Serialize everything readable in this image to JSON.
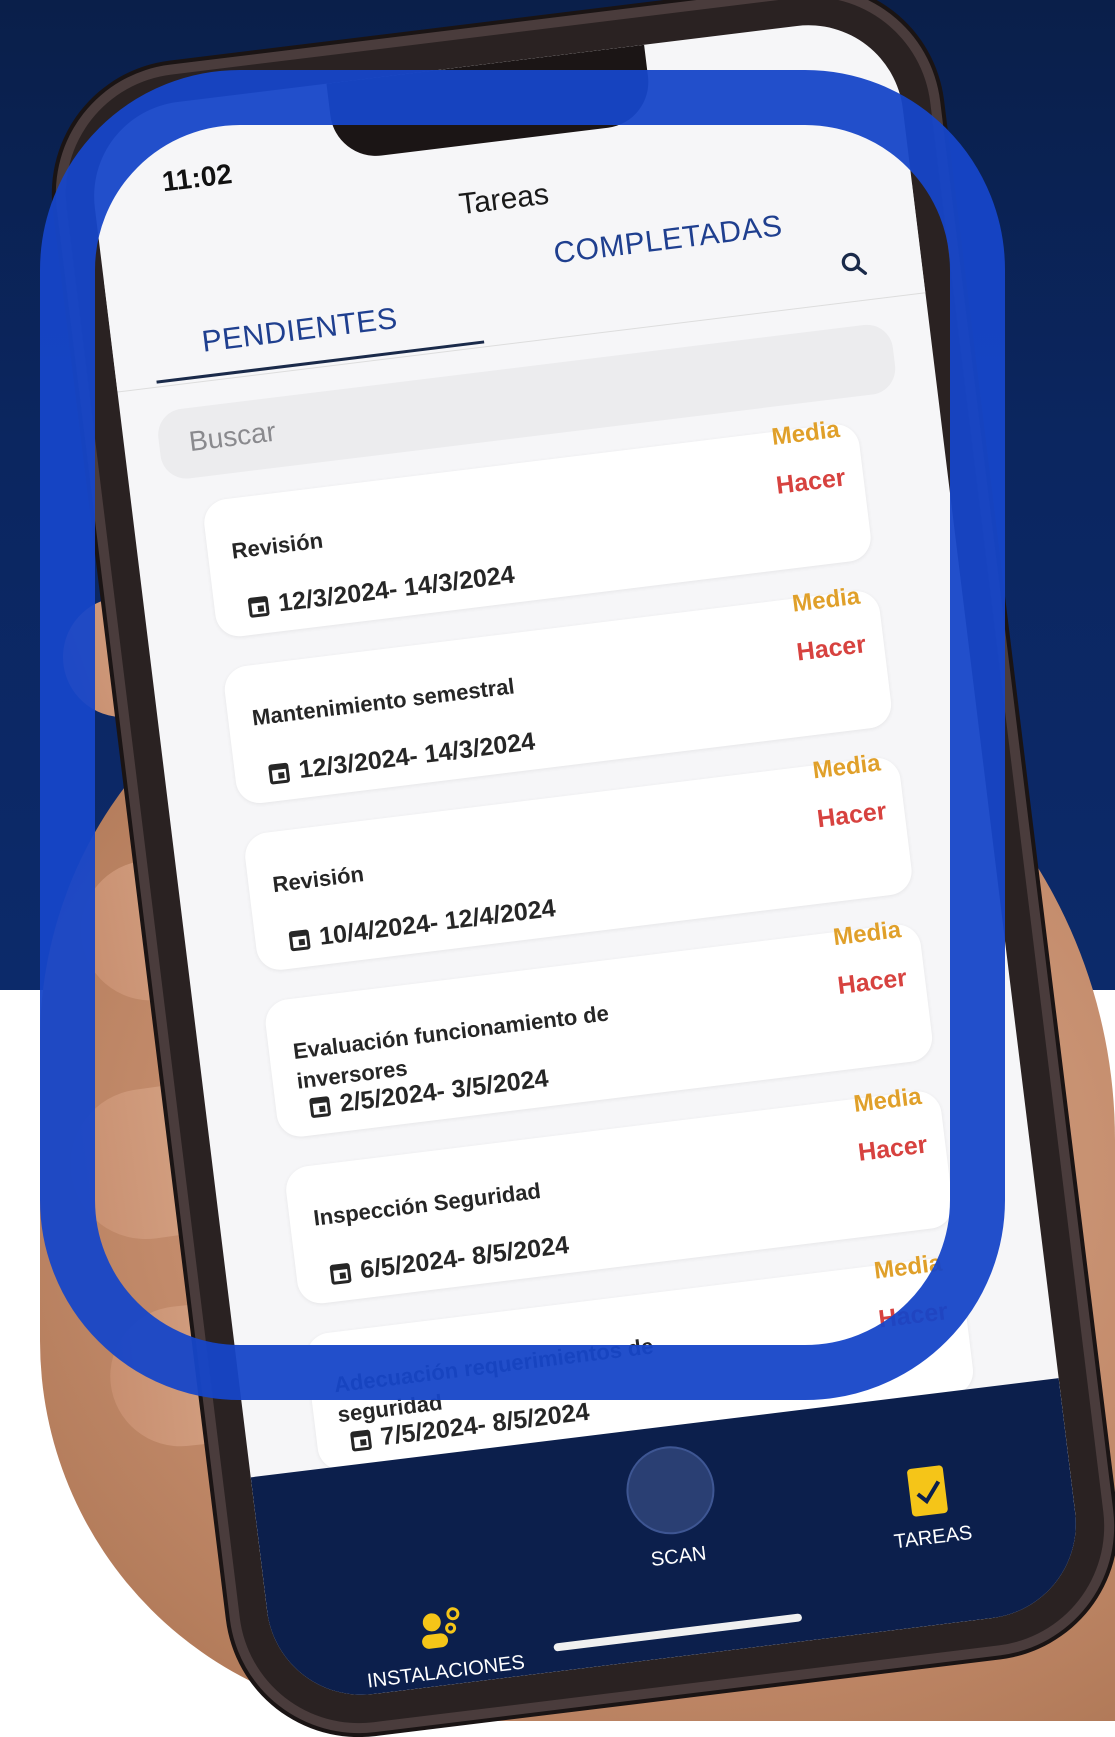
{
  "status_bar": {
    "time": "11:02"
  },
  "header": {
    "title": "Tareas"
  },
  "tabs": [
    {
      "label": "PENDIENTES",
      "active": true
    },
    {
      "label": "COMPLETADAS",
      "active": false
    }
  ],
  "search": {
    "placeholder": "Buscar"
  },
  "tasks": [
    {
      "name": "Revisión",
      "priority": "Media",
      "action": "Hacer",
      "dates": "12/3/2024- 14/3/2024"
    },
    {
      "name": "Mantenimiento semestral",
      "priority": "Media",
      "action": "Hacer",
      "dates": "12/3/2024- 14/3/2024"
    },
    {
      "name": "Revisión",
      "priority": "Media",
      "action": "Hacer",
      "dates": "10/4/2024- 12/4/2024"
    },
    {
      "name": "Evaluación funcionamiento de inversores",
      "priority": "Media",
      "action": "Hacer",
      "dates": "2/5/2024- 3/5/2024"
    },
    {
      "name": "Inspección Seguridad",
      "priority": "Media",
      "action": "Hacer",
      "dates": "6/5/2024- 8/5/2024"
    },
    {
      "name": "Adecuación requerimientos de seguridad",
      "priority": "Media",
      "action": "Hacer",
      "dates": "7/5/2024- 8/5/2024"
    }
  ],
  "bottom_nav": {
    "installations": "INSTALACIONES",
    "scan": "SCAN",
    "tasks": "TAREAS"
  },
  "colors": {
    "accent": "#1f3f8f",
    "priority": "#e0a02a",
    "action": "#d7423f",
    "nav_bg": "#0c1f4c",
    "frame": "#1646c8"
  }
}
